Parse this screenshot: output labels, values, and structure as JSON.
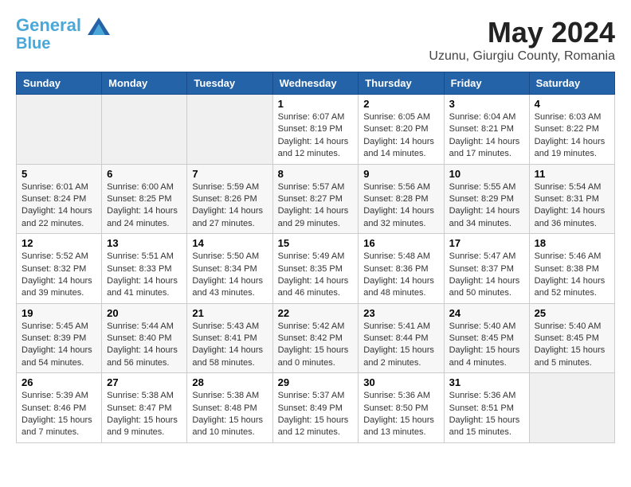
{
  "header": {
    "logo_line1": "General",
    "logo_line2": "Blue",
    "month_title": "May 2024",
    "location": "Uzunu, Giurgiu County, Romania"
  },
  "weekdays": [
    "Sunday",
    "Monday",
    "Tuesday",
    "Wednesday",
    "Thursday",
    "Friday",
    "Saturday"
  ],
  "weeks": [
    [
      {
        "day": "",
        "info": ""
      },
      {
        "day": "",
        "info": ""
      },
      {
        "day": "",
        "info": ""
      },
      {
        "day": "1",
        "info": "Sunrise: 6:07 AM\nSunset: 8:19 PM\nDaylight: 14 hours\nand 12 minutes."
      },
      {
        "day": "2",
        "info": "Sunrise: 6:05 AM\nSunset: 8:20 PM\nDaylight: 14 hours\nand 14 minutes."
      },
      {
        "day": "3",
        "info": "Sunrise: 6:04 AM\nSunset: 8:21 PM\nDaylight: 14 hours\nand 17 minutes."
      },
      {
        "day": "4",
        "info": "Sunrise: 6:03 AM\nSunset: 8:22 PM\nDaylight: 14 hours\nand 19 minutes."
      }
    ],
    [
      {
        "day": "5",
        "info": "Sunrise: 6:01 AM\nSunset: 8:24 PM\nDaylight: 14 hours\nand 22 minutes."
      },
      {
        "day": "6",
        "info": "Sunrise: 6:00 AM\nSunset: 8:25 PM\nDaylight: 14 hours\nand 24 minutes."
      },
      {
        "day": "7",
        "info": "Sunrise: 5:59 AM\nSunset: 8:26 PM\nDaylight: 14 hours\nand 27 minutes."
      },
      {
        "day": "8",
        "info": "Sunrise: 5:57 AM\nSunset: 8:27 PM\nDaylight: 14 hours\nand 29 minutes."
      },
      {
        "day": "9",
        "info": "Sunrise: 5:56 AM\nSunset: 8:28 PM\nDaylight: 14 hours\nand 32 minutes."
      },
      {
        "day": "10",
        "info": "Sunrise: 5:55 AM\nSunset: 8:29 PM\nDaylight: 14 hours\nand 34 minutes."
      },
      {
        "day": "11",
        "info": "Sunrise: 5:54 AM\nSunset: 8:31 PM\nDaylight: 14 hours\nand 36 minutes."
      }
    ],
    [
      {
        "day": "12",
        "info": "Sunrise: 5:52 AM\nSunset: 8:32 PM\nDaylight: 14 hours\nand 39 minutes."
      },
      {
        "day": "13",
        "info": "Sunrise: 5:51 AM\nSunset: 8:33 PM\nDaylight: 14 hours\nand 41 minutes."
      },
      {
        "day": "14",
        "info": "Sunrise: 5:50 AM\nSunset: 8:34 PM\nDaylight: 14 hours\nand 43 minutes."
      },
      {
        "day": "15",
        "info": "Sunrise: 5:49 AM\nSunset: 8:35 PM\nDaylight: 14 hours\nand 46 minutes."
      },
      {
        "day": "16",
        "info": "Sunrise: 5:48 AM\nSunset: 8:36 PM\nDaylight: 14 hours\nand 48 minutes."
      },
      {
        "day": "17",
        "info": "Sunrise: 5:47 AM\nSunset: 8:37 PM\nDaylight: 14 hours\nand 50 minutes."
      },
      {
        "day": "18",
        "info": "Sunrise: 5:46 AM\nSunset: 8:38 PM\nDaylight: 14 hours\nand 52 minutes."
      }
    ],
    [
      {
        "day": "19",
        "info": "Sunrise: 5:45 AM\nSunset: 8:39 PM\nDaylight: 14 hours\nand 54 minutes."
      },
      {
        "day": "20",
        "info": "Sunrise: 5:44 AM\nSunset: 8:40 PM\nDaylight: 14 hours\nand 56 minutes."
      },
      {
        "day": "21",
        "info": "Sunrise: 5:43 AM\nSunset: 8:41 PM\nDaylight: 14 hours\nand 58 minutes."
      },
      {
        "day": "22",
        "info": "Sunrise: 5:42 AM\nSunset: 8:42 PM\nDaylight: 15 hours\nand 0 minutes."
      },
      {
        "day": "23",
        "info": "Sunrise: 5:41 AM\nSunset: 8:44 PM\nDaylight: 15 hours\nand 2 minutes."
      },
      {
        "day": "24",
        "info": "Sunrise: 5:40 AM\nSunset: 8:45 PM\nDaylight: 15 hours\nand 4 minutes."
      },
      {
        "day": "25",
        "info": "Sunrise: 5:40 AM\nSunset: 8:45 PM\nDaylight: 15 hours\nand 5 minutes."
      }
    ],
    [
      {
        "day": "26",
        "info": "Sunrise: 5:39 AM\nSunset: 8:46 PM\nDaylight: 15 hours\nand 7 minutes."
      },
      {
        "day": "27",
        "info": "Sunrise: 5:38 AM\nSunset: 8:47 PM\nDaylight: 15 hours\nand 9 minutes."
      },
      {
        "day": "28",
        "info": "Sunrise: 5:38 AM\nSunset: 8:48 PM\nDaylight: 15 hours\nand 10 minutes."
      },
      {
        "day": "29",
        "info": "Sunrise: 5:37 AM\nSunset: 8:49 PM\nDaylight: 15 hours\nand 12 minutes."
      },
      {
        "day": "30",
        "info": "Sunrise: 5:36 AM\nSunset: 8:50 PM\nDaylight: 15 hours\nand 13 minutes."
      },
      {
        "day": "31",
        "info": "Sunrise: 5:36 AM\nSunset: 8:51 PM\nDaylight: 15 hours\nand 15 minutes."
      },
      {
        "day": "",
        "info": ""
      }
    ]
  ]
}
